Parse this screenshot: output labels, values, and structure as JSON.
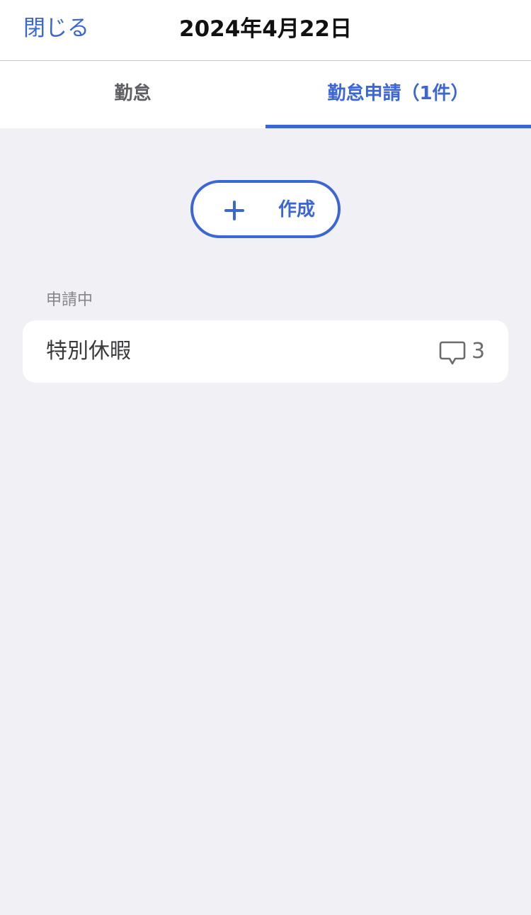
{
  "nav": {
    "close_label": "閉じる",
    "title": "2024年4月22日"
  },
  "tabs": [
    {
      "label": "勤怠",
      "selected": false
    },
    {
      "label": "勤怠申請（1件）",
      "selected": true
    }
  ],
  "create_button": {
    "icon": "plus-icon",
    "label": "作成"
  },
  "section": {
    "header": "申請中",
    "items": [
      {
        "title": "特別休暇",
        "comment_icon": "comment-icon",
        "comment_count": "3"
      }
    ]
  },
  "colors": {
    "accent": "#3b66d6",
    "background": "#f0f0f5",
    "card": "#ffffff"
  }
}
